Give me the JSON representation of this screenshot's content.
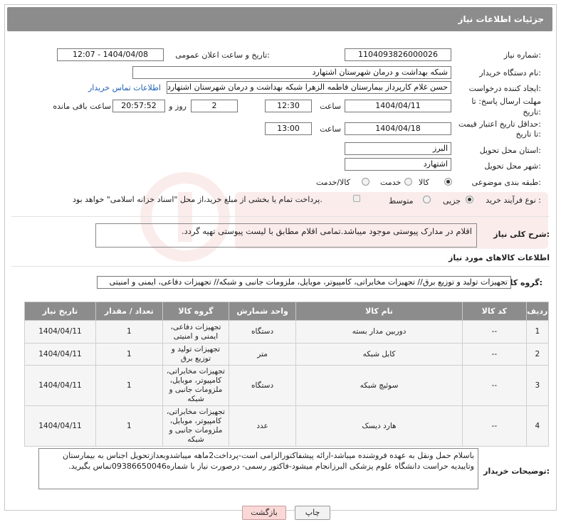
{
  "header": {
    "title": "جزئیات اطلاعات نیاز"
  },
  "fields": {
    "need_number_label": "شماره نیاز:",
    "need_number": "1104093826000026",
    "announce_label": "تاریخ و ساعت اعلان عمومی:",
    "announce_value": "1404/04/08 - 12:07",
    "buyer_org_label": "نام دستگاه خریدار:",
    "buyer_org": "شبکه بهداشت و درمان شهرستان اشتهارد",
    "requester_label": "ایجاد کننده درخواست:",
    "requester": "حسن غلام کارپرداز بیمارستان فاطمه الزهرا شبکه بهداشت و درمان شهرستان اشتهارد",
    "contact_link": "اطلاعات تماس خریدار",
    "deadline_label_1": "مهلت ارسال پاسخ: تا",
    "deadline_label_2": "تاریخ:",
    "deadline_date": "1404/04/11",
    "time_label": "ساعت",
    "deadline_time": "12:30",
    "days_value": "2",
    "days_label": "روز و",
    "remaining_time": "20:57:52",
    "remaining_label": "ساعت باقی مانده",
    "min_validity_label_1": "حداقل تاریخ اعتبار قیمت:",
    "min_validity_label_2": "تا تاریخ:",
    "validity_date": "1404/04/18",
    "validity_time": "13:00",
    "province_label": "استان محل تحویل:",
    "province": "البرز",
    "city_label": "شهر محل تحویل:",
    "city": "اشتهارد",
    "category_label": "طبقه بندی موضوعی:",
    "category_options": [
      "کالا",
      "خدمت",
      "کالا/خدمت"
    ],
    "category_selected": "کالا",
    "process_label": "نوع فرآیند خرید :",
    "process_options": [
      "جزیی",
      "متوسط"
    ],
    "process_selected": "جزیی",
    "payment_note": "پرداخت تمام یا بخشی از مبلغ خرید،از محل \"اسناد خزانه اسلامی\" خواهد بود."
  },
  "description": {
    "label": "شرح کلی نیاز:",
    "text": "اقلام در مدارک پیوستی موجود میباشد.تمامی اقلام مطابق با لیست پیوستی تهیه گردد."
  },
  "goods_section": {
    "title": "اطلاعات کالاهای مورد نیاز",
    "group_label": "گروه کالا:",
    "group_value": "تجهیزات تولید و توزیع برق// تجهیزات مخابراتی، کامپیوتر، موبایل، ملزومات جانبی و شبکه// تجهیزات دفاعی، ایمنی و امنیتی"
  },
  "table": {
    "headers": [
      "ردیف",
      "کد کالا",
      "نام کالا",
      "واحد شمارش",
      "گروه کالا",
      "تعداد / مقدار",
      "تاریخ نیاز"
    ],
    "rows": [
      [
        "1",
        "--",
        "دوربین مدار بسته",
        "دستگاه",
        "تجهیزات دفاعی، ایمنی و امنیتی",
        "1",
        "1404/04/11"
      ],
      [
        "2",
        "--",
        "کابل شبکه",
        "متر",
        "تجهیزات تولید و توزیع برق",
        "1",
        "1404/04/11"
      ],
      [
        "3",
        "--",
        "سوئیچ شبکه",
        "دستگاه",
        "تجهیزات مخابراتی، کامپیوتر، موبایل، ملزومات جانبی و شبکه",
        "1",
        "1404/04/11"
      ],
      [
        "4",
        "--",
        "هارد دیسک",
        "عدد",
        "تجهیزات مخابراتی، کامپیوتر، موبایل، ملزومات جانبی و شبکه",
        "1",
        "1404/04/11"
      ]
    ]
  },
  "buyer_notes": {
    "label": "توضیحات خریدار:",
    "text": "باسلام حمل ونقل به عهده فروشنده میباشد-ارائه پیشفاکتورالزامی است-پرداخت2ماهه میباشدوبعدازتحویل اجناس به بیمارستان وتاییدیه حراست دانشگاه علوم پزشکی البرزانجام میشود-فاکتور رسمی- درصورت نیاز با شماره09386650046تماس بگیرید."
  },
  "buttons": {
    "print": "چاپ",
    "back": "بازگشت"
  },
  "colors": {
    "header_bg": "#8c8c8c",
    "link": "#1a5fb4",
    "back_button": "#fbd8d8"
  }
}
